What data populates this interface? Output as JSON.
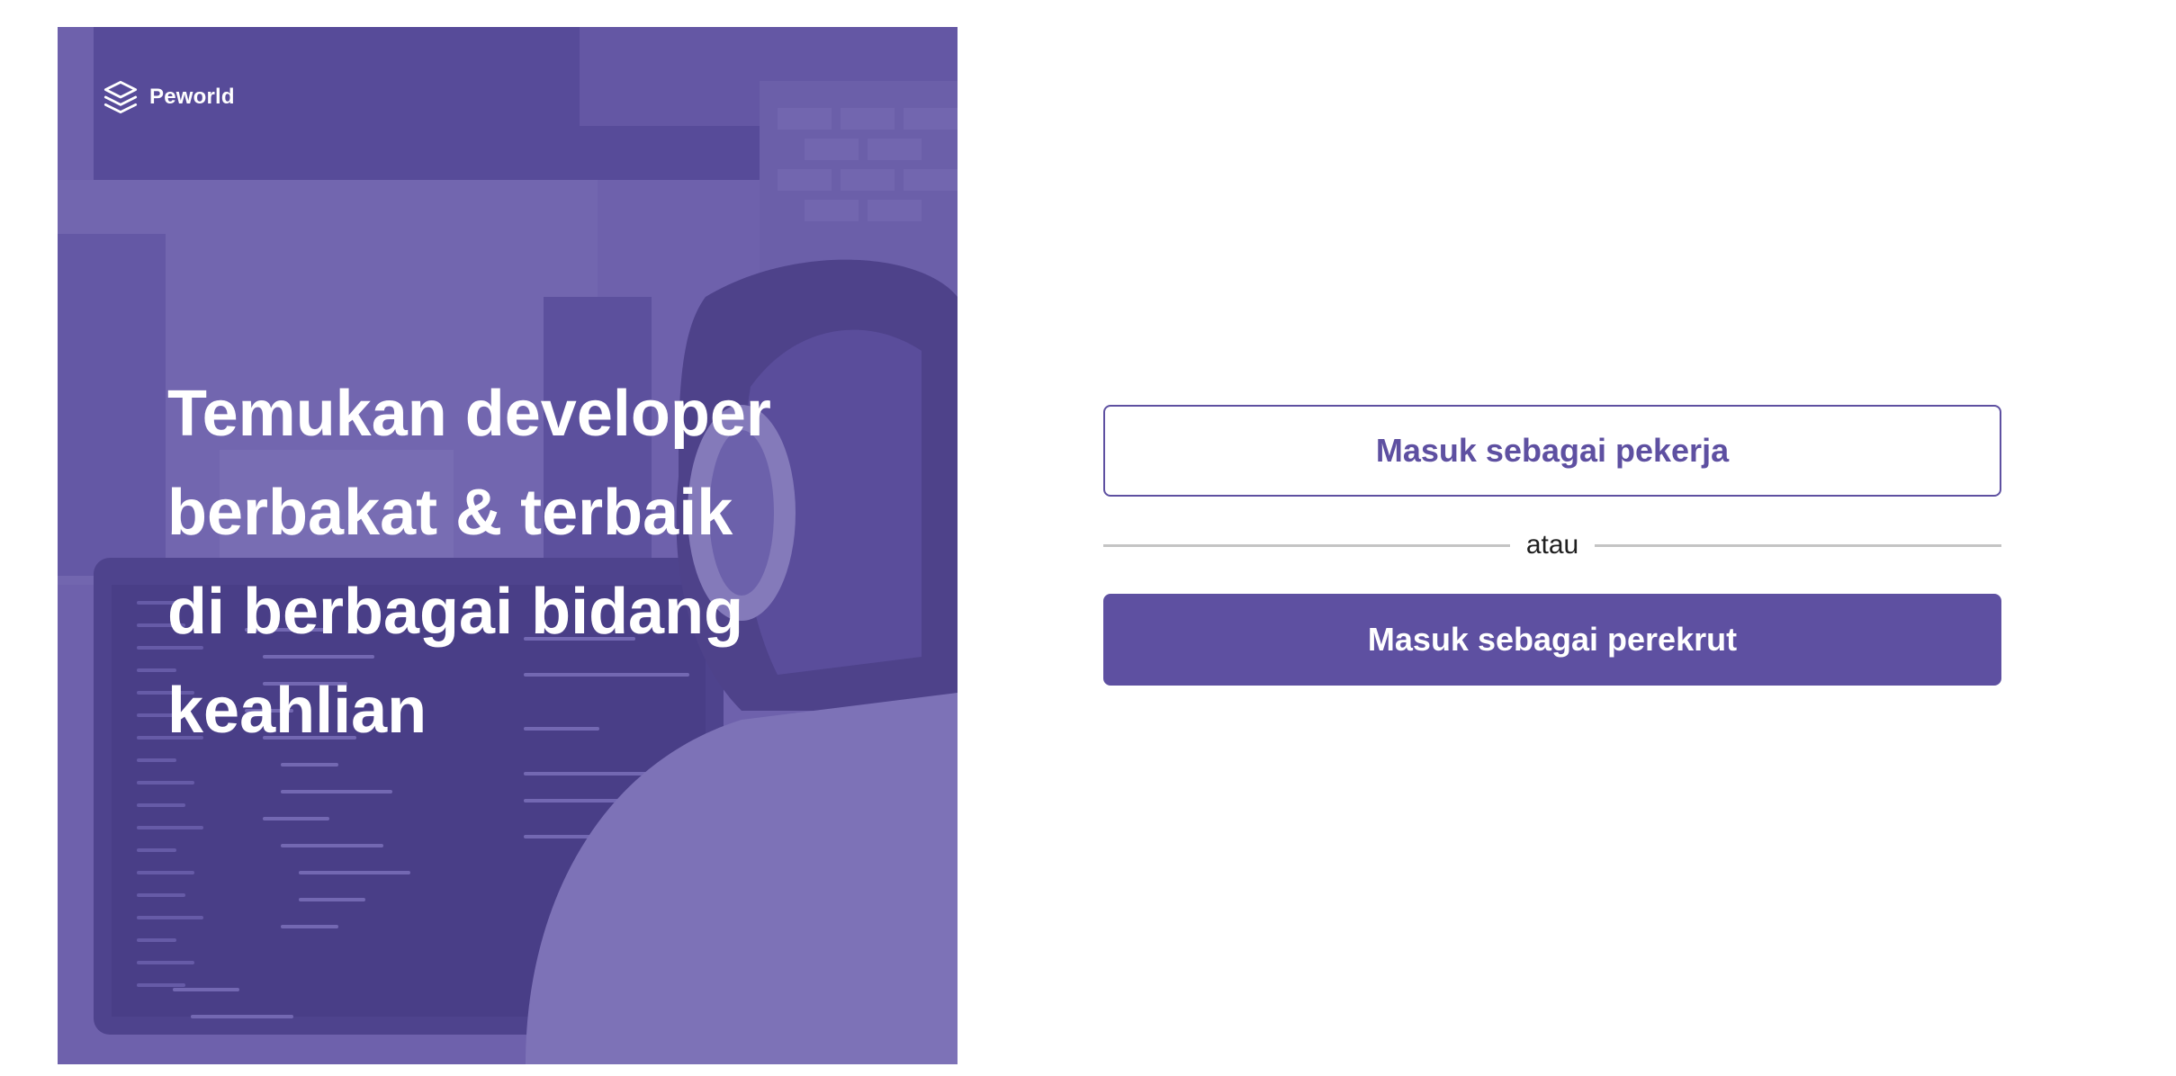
{
  "brand": {
    "name": "Peworld",
    "icon": "layers-icon"
  },
  "hero": {
    "headline_lines": [
      "Temukan developer",
      "berbakat & terbaik",
      "di berbagai bidang",
      "keahlian"
    ],
    "overlay_color": "#5E50A1"
  },
  "auth": {
    "worker_button_label": "Masuk sebagai pekerja",
    "divider_text": "atau",
    "recruiter_button_label": "Masuk sebagai perekrut"
  },
  "colors": {
    "primary": "#5E50A1",
    "divider": "#C4C4C4"
  }
}
